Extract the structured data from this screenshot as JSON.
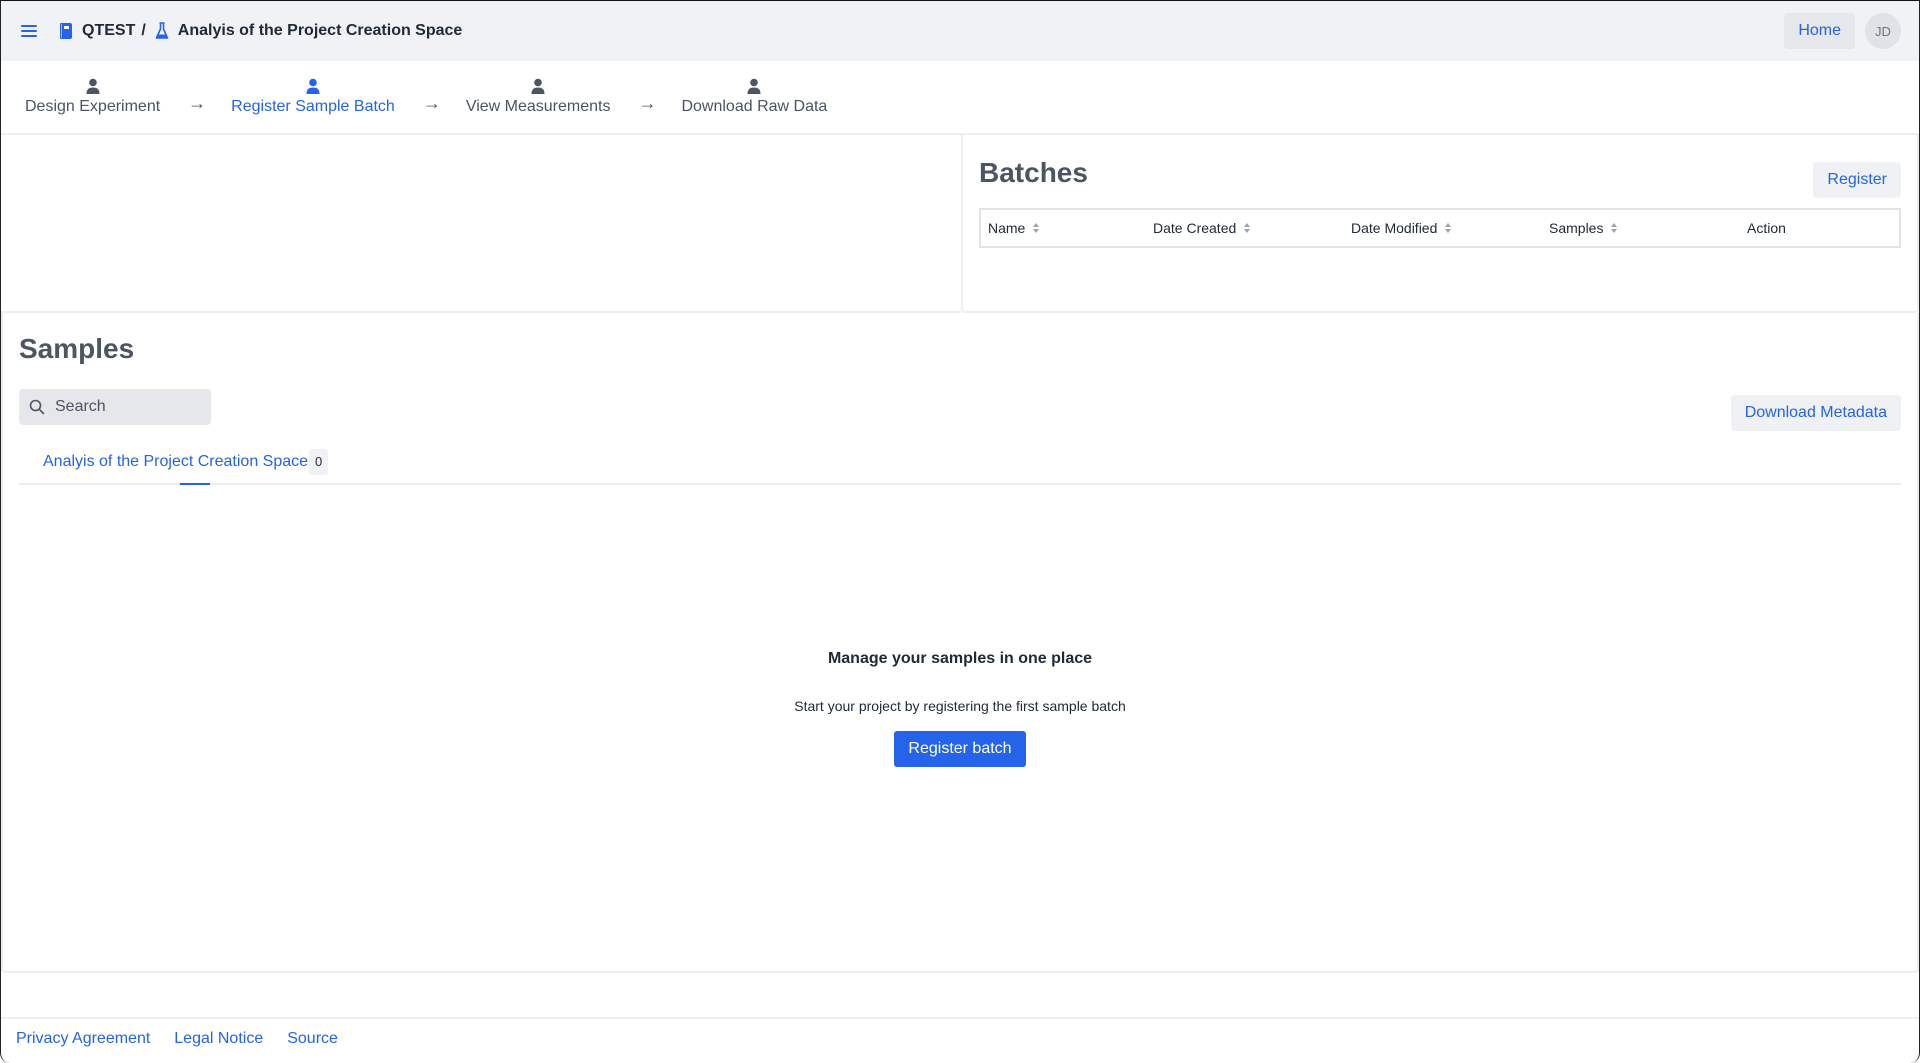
{
  "topbar": {
    "menu_icon": "hamburger-menu-icon",
    "project_code": "QTEST",
    "separator": "/",
    "experiment_title": "Analyis of the Project Creation Space",
    "home_label": "Home",
    "avatar_initials": "JD"
  },
  "stepper": {
    "steps": [
      {
        "label": "Design Experiment",
        "icon": "person-icon",
        "active": false
      },
      {
        "label": "Register Sample Batch",
        "icon": "person-icon",
        "active": true
      },
      {
        "label": "View Measurements",
        "icon": "person-icon",
        "active": false
      },
      {
        "label": "Download Raw Data",
        "icon": "person-icon",
        "active": false
      }
    ],
    "arrow": "→"
  },
  "batches": {
    "title": "Batches",
    "register_label": "Register",
    "columns": [
      {
        "label": "Name",
        "sortable": true
      },
      {
        "label": "Date Created",
        "sortable": true
      },
      {
        "label": "Date Modified",
        "sortable": true
      },
      {
        "label": "Samples",
        "sortable": true
      },
      {
        "label": "Action",
        "sortable": false
      }
    ],
    "rows": []
  },
  "samples": {
    "title": "Samples",
    "search_placeholder": "Search",
    "download_metadata_label": "Download Metadata",
    "tabs": [
      {
        "label": "Analyis of the Project Creation Space",
        "count": "0",
        "active": true
      }
    ],
    "empty_state": {
      "title": "Manage your samples in one place",
      "subtitle": "Start your project by registering the first sample batch",
      "cta_label": "Register batch"
    }
  },
  "footer": {
    "links": [
      "Privacy Agreement",
      "Legal Notice",
      "Source"
    ]
  },
  "colors": {
    "accent": "#2563eb",
    "topbar_bg": "#f1f2f6",
    "heading": "#4b5563"
  }
}
